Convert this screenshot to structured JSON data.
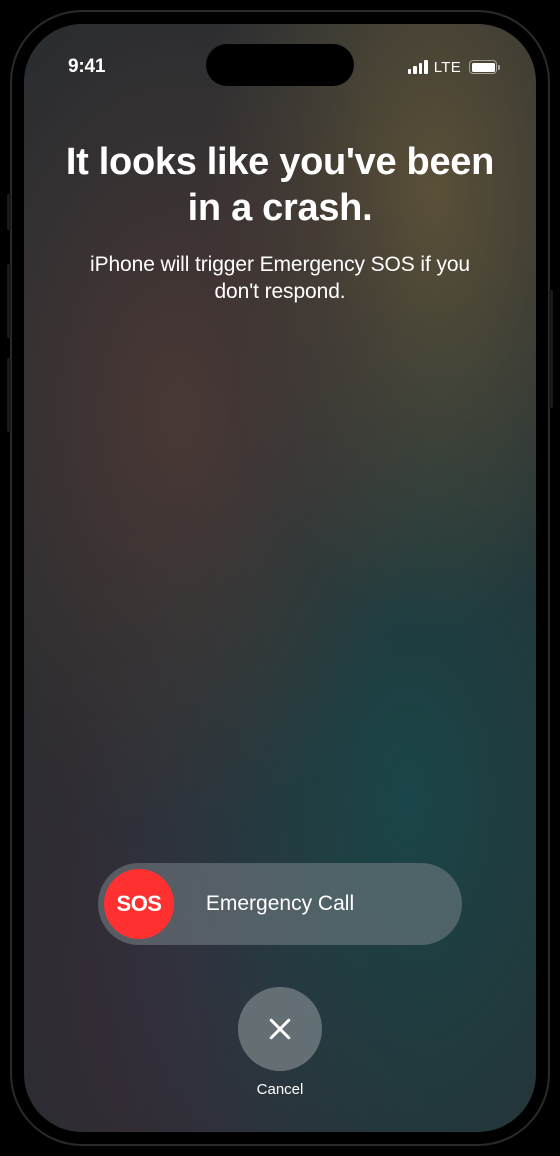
{
  "status": {
    "time": "9:41",
    "network": "LTE"
  },
  "crash": {
    "headline": "It looks like you've been in a crash.",
    "subtext": "iPhone will trigger Emergency SOS if you don't respond."
  },
  "slider": {
    "knob_label": "SOS",
    "track_label": "Emergency Call"
  },
  "cancel": {
    "label": "Cancel"
  },
  "colors": {
    "sos_red": "#ff3130"
  }
}
